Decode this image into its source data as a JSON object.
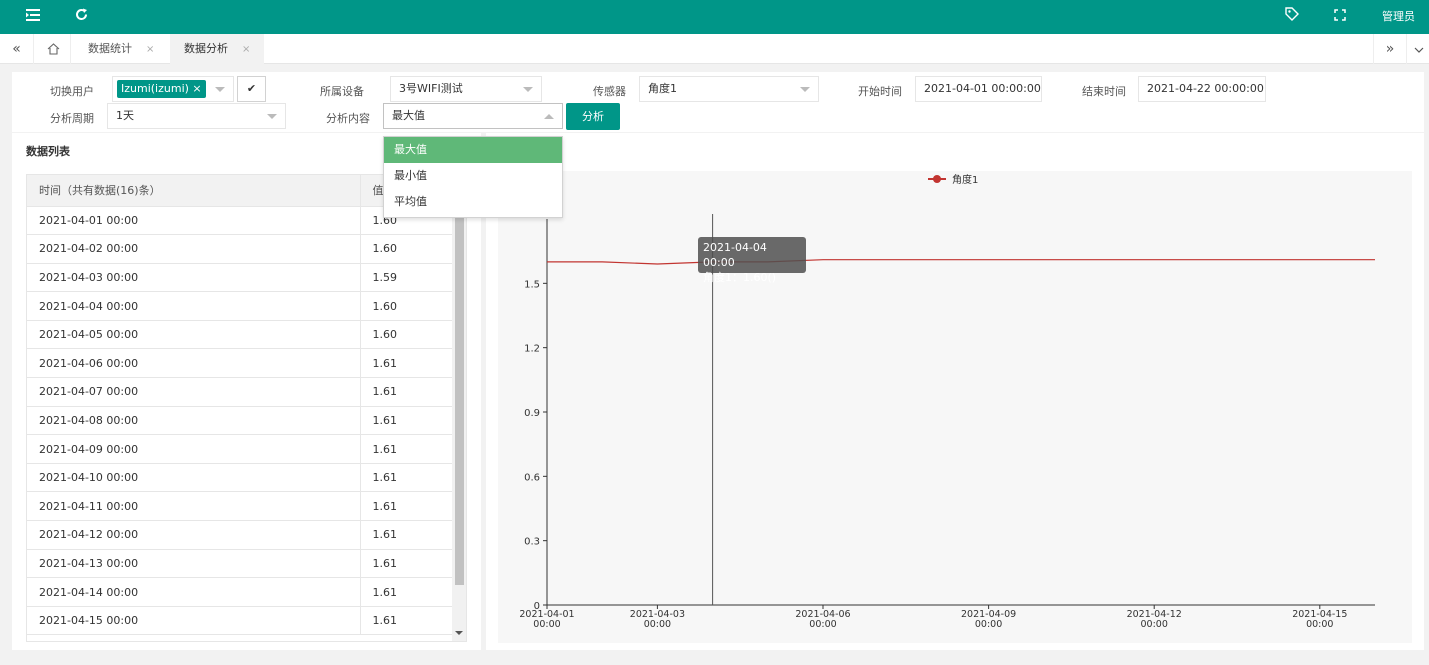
{
  "topbar": {
    "menu_icon": "menu-icon",
    "refresh_icon": "refresh-icon",
    "tag_icon": "tag-icon",
    "fullscreen_icon": "fullscreen-icon",
    "user": "管理员",
    "color": "#009688"
  },
  "tabs": [
    {
      "label": "数据统计",
      "close": "×",
      "active": false
    },
    {
      "label": "数据分析",
      "close": "×",
      "active": true
    }
  ],
  "filters": {
    "user_label": "切换用户",
    "user_tag": "Izumi(izumi)",
    "user_tag_close": "×",
    "check": "✔",
    "device_label": "所属设备",
    "device_value": "3号WIFI测试",
    "sensor_label": "传感器",
    "sensor_value": "角度1",
    "start_label": "开始时间",
    "start_value": "2021-04-01 00:00:00",
    "end_label": "结束时间",
    "end_value": "2021-04-22 00:00:00",
    "period_label": "分析周期",
    "period_value": "1天",
    "content_label": "分析内容",
    "content_value": "最大值",
    "analyze_button": "分析"
  },
  "dropdown": {
    "options": [
      "最大值",
      "最小值",
      "平均值"
    ],
    "selected": "最大值",
    "selected_color": "#5fb878"
  },
  "data_list": {
    "title": "数据列表",
    "columns": [
      "时间（共有数据(16)条）",
      "值"
    ],
    "rows": [
      [
        "2021-04-01 00:00",
        "1.60"
      ],
      [
        "2021-04-02 00:00",
        "1.60"
      ],
      [
        "2021-04-03 00:00",
        "1.59"
      ],
      [
        "2021-04-04 00:00",
        "1.60"
      ],
      [
        "2021-04-05 00:00",
        "1.60"
      ],
      [
        "2021-04-06 00:00",
        "1.61"
      ],
      [
        "2021-04-07 00:00",
        "1.61"
      ],
      [
        "2021-04-08 00:00",
        "1.61"
      ],
      [
        "2021-04-09 00:00",
        "1.61"
      ],
      [
        "2021-04-10 00:00",
        "1.61"
      ],
      [
        "2021-04-11 00:00",
        "1.61"
      ],
      [
        "2021-04-12 00:00",
        "1.61"
      ],
      [
        "2021-04-13 00:00",
        "1.61"
      ],
      [
        "2021-04-14 00:00",
        "1.61"
      ],
      [
        "2021-04-15 00:00",
        "1.61"
      ]
    ]
  },
  "tooltip": {
    "date": "2021-04-04 00:00",
    "value": "角度1：1.60()"
  },
  "chart_data": {
    "type": "line",
    "title": "",
    "xlabel": "",
    "ylabel": "",
    "legend": "top-center",
    "grid": false,
    "series": [
      {
        "name": "角度1",
        "color": "#c23531",
        "x": [
          "2021-04-01",
          "2021-04-02",
          "2021-04-03",
          "2021-04-04",
          "2021-04-05",
          "2021-04-06",
          "2021-04-07",
          "2021-04-08",
          "2021-04-09",
          "2021-04-10",
          "2021-04-11",
          "2021-04-12",
          "2021-04-13",
          "2021-04-14",
          "2021-04-15",
          "2021-04-16"
        ],
        "values": [
          1.6,
          1.6,
          1.59,
          1.6,
          1.6,
          1.61,
          1.61,
          1.61,
          1.61,
          1.61,
          1.61,
          1.61,
          1.61,
          1.61,
          1.61,
          1.61
        ]
      }
    ],
    "xlim": [
      "2021-04-01",
      "2021-04-16"
    ],
    "x_ticks": [
      {
        "date": "2021-04-01",
        "label": "2021-04-01",
        "label2": "00:00"
      },
      {
        "date": "2021-04-03",
        "label": "2021-04-03",
        "label2": "00:00"
      },
      {
        "date": "2021-04-06",
        "label": "2021-04-06",
        "label2": "00:00"
      },
      {
        "date": "2021-04-09",
        "label": "2021-04-09",
        "label2": "00:00"
      },
      {
        "date": "2021-04-12",
        "label": "2021-04-12",
        "label2": "00:00"
      },
      {
        "date": "2021-04-15",
        "label": "2021-04-15",
        "label2": "00:00"
      }
    ],
    "ylim": [
      0,
      1.8
    ],
    "y_ticks": [
      "0",
      "0.3",
      "0.6",
      "0.9",
      "1.2",
      "1.5"
    ],
    "y_tick_values": [
      0,
      0.3,
      0.6,
      0.9,
      1.2,
      1.5
    ],
    "crosshair_date": "2021-04-04"
  }
}
